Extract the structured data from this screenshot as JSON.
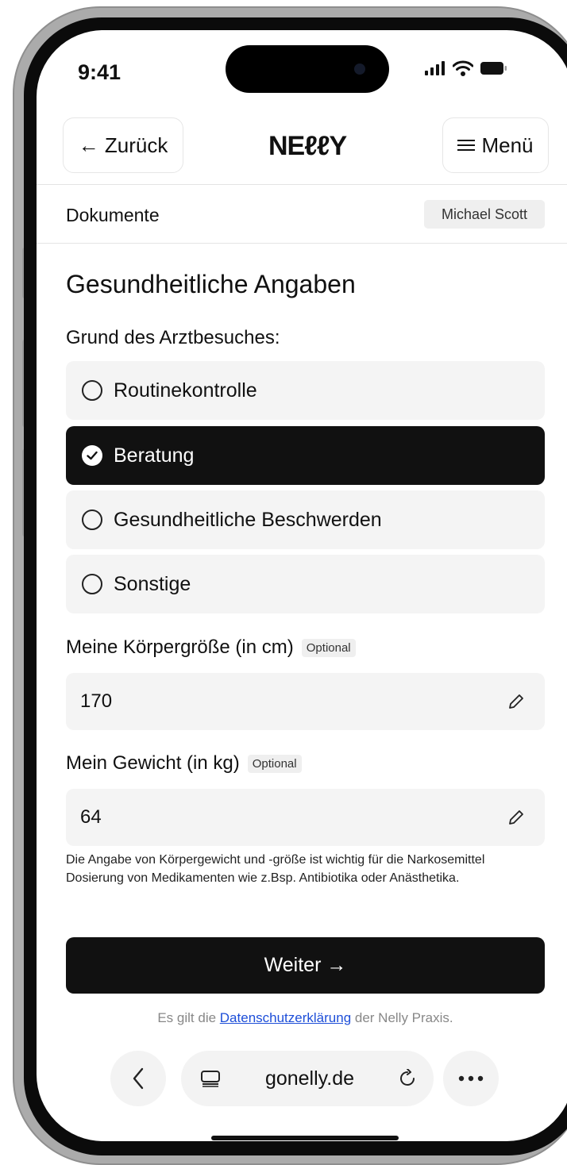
{
  "status_bar": {
    "time": "9:41"
  },
  "header": {
    "back_label": "← Zurück",
    "logo": "NEℓℓY",
    "menu_label": "Menü"
  },
  "subheader": {
    "section": "Dokumente",
    "user": "Michael Scott"
  },
  "form": {
    "title": "Gesundheitliche Angaben",
    "reason_label": "Grund des Arztbesuches:",
    "options": [
      {
        "label": "Routinekontrolle",
        "selected": false
      },
      {
        "label": "Beratung",
        "selected": true
      },
      {
        "label": "Gesundheitliche Beschwerden",
        "selected": false
      },
      {
        "label": "Sonstige",
        "selected": false
      }
    ],
    "height_label": "Meine Körpergröße (in cm)",
    "height_optional": "Optional",
    "height_value": "170",
    "weight_label": "Mein Gewicht (in kg)",
    "weight_optional": "Optional",
    "weight_value": "64",
    "note": "Die Angabe von Körpergewicht und -größe ist wichtig für die Narkosemittel Dosierung von Medikamenten wie z.Bsp. Antibiotika oder Anästhetika.",
    "submit_label": "Weiter →",
    "privacy_prefix": "Es gilt die ",
    "privacy_link": "Datenschutzerklärung",
    "privacy_suffix": " der Nelly Praxis."
  },
  "browser": {
    "url": "gonelly.de"
  },
  "colors": {
    "primary": "#111111",
    "field_bg": "#f4f4f4",
    "link": "#1d4ed8"
  }
}
